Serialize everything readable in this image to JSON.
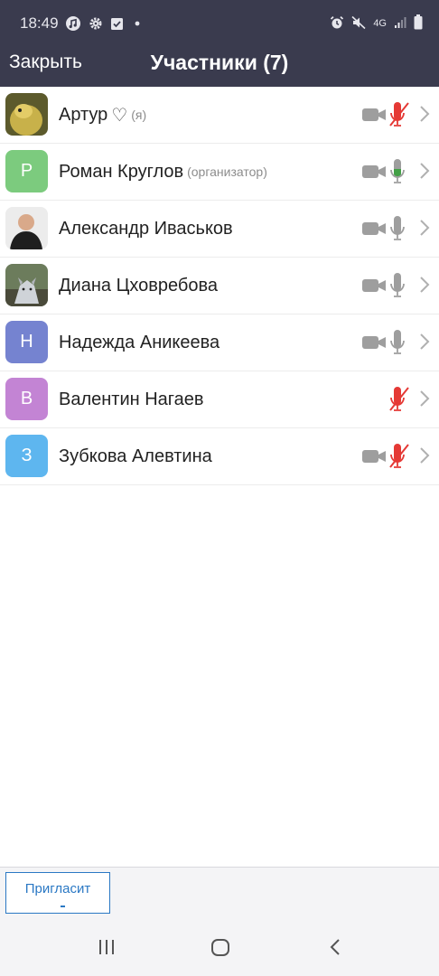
{
  "status_bar": {
    "time": "18:49",
    "network": "4G",
    "icons": [
      "music-icon",
      "gear-icon",
      "checkbox-icon",
      "dot-icon",
      "alarm-icon",
      "mute-icon",
      "signal-icon",
      "battery-icon"
    ]
  },
  "header": {
    "close_label": "Закрыть",
    "title": "Участники (7)"
  },
  "participants": [
    {
      "name": "Артур",
      "heart": "♡",
      "tag": "(я)",
      "avatar_type": "photo",
      "avatar_letter": "",
      "avatar_color": "#8a7a3a",
      "video": true,
      "mic": "muted"
    },
    {
      "name": "Роман Круглов",
      "heart": "",
      "tag": "(организатор)",
      "avatar_type": "letter",
      "avatar_letter": "Р",
      "avatar_color": "#7ccb7e",
      "video": true,
      "mic": "active"
    },
    {
      "name": "Александр Иваськов",
      "heart": "",
      "tag": "",
      "avatar_type": "photo",
      "avatar_letter": "",
      "avatar_color": "#3a3a3a",
      "video": true,
      "mic": "on"
    },
    {
      "name": "Диана Цховребова",
      "heart": "",
      "tag": "",
      "avatar_type": "photo",
      "avatar_letter": "",
      "avatar_color": "#7a8a9a",
      "video": true,
      "mic": "on"
    },
    {
      "name": "Надежда Аникеева",
      "heart": "",
      "tag": "",
      "avatar_type": "letter",
      "avatar_letter": "Н",
      "avatar_color": "#7583d0",
      "video": true,
      "mic": "on"
    },
    {
      "name": "Валентин Нагаев",
      "heart": "",
      "tag": "",
      "avatar_type": "letter",
      "avatar_letter": "В",
      "avatar_color": "#c384d4",
      "video": false,
      "mic": "muted"
    },
    {
      "name": "Зубкова Алевтина",
      "heart": "",
      "tag": "",
      "avatar_type": "letter",
      "avatar_letter": "З",
      "avatar_color": "#5eb6ef",
      "video": true,
      "mic": "muted"
    }
  ],
  "bottom": {
    "invite_label": "Пригласит"
  },
  "colors": {
    "header_bg": "#3a3b4e",
    "muted_mic": "#e53935",
    "active_mic": "#43a047",
    "icon_gray": "#9e9e9e",
    "accent": "#2a78c4"
  },
  "nav_bar": {
    "icons": [
      "recent-apps-icon",
      "home-icon",
      "back-icon"
    ]
  }
}
